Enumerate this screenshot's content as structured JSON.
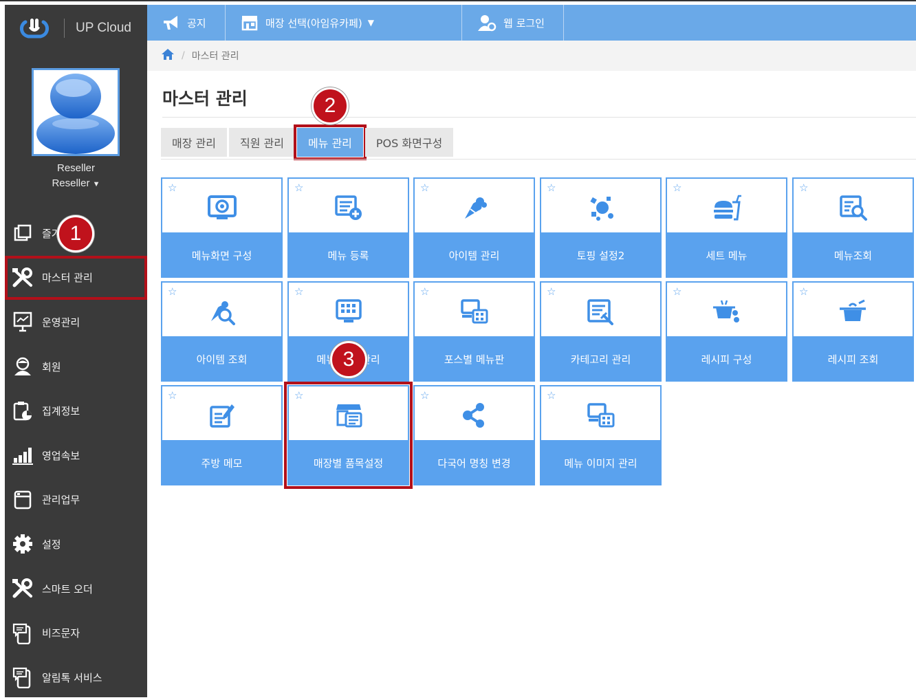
{
  "app": {
    "brand": "UP Cloud"
  },
  "topbar": {
    "notice": "공지",
    "store_select": "매장 선택(아임유카페)",
    "web_login": "웹 로그인"
  },
  "user": {
    "name": "Reseller",
    "role": "Reseller"
  },
  "sidebar": {
    "items": [
      {
        "label": "즐겨찾기",
        "icon": "bookmark-icon"
      },
      {
        "label": "마스터 관리",
        "icon": "tools-icon"
      },
      {
        "label": "운영관리",
        "icon": "monitor-chart-icon"
      },
      {
        "label": "회원",
        "icon": "member-icon"
      },
      {
        "label": "집계정보",
        "icon": "clipboard-chart-icon"
      },
      {
        "label": "영업속보",
        "icon": "bar-chart-icon"
      },
      {
        "label": "관리업무",
        "icon": "document-icon"
      },
      {
        "label": "설정",
        "icon": "gear-icon"
      },
      {
        "label": "스마트 오더",
        "icon": "tools-icon"
      },
      {
        "label": "비즈문자",
        "icon": "phone-chat-icon"
      },
      {
        "label": "알림톡 서비스",
        "icon": "phone-chat-icon"
      }
    ]
  },
  "breadcrumb": {
    "current": "마스터 관리"
  },
  "page": {
    "title": "마스터 관리"
  },
  "tabs": [
    "매장 관리",
    "직원 관리",
    "메뉴 관리",
    "POS 화면구성"
  ],
  "tiles": [
    {
      "label": "메뉴화면 구성",
      "icon": "screen-settings-icon"
    },
    {
      "label": "메뉴 등록",
      "icon": "list-add-icon"
    },
    {
      "label": "아이템 관리",
      "icon": "food-icon"
    },
    {
      "label": "토핑 설정2",
      "icon": "topping-icon"
    },
    {
      "label": "세트 메뉴",
      "icon": "burger-set-icon"
    },
    {
      "label": "메뉴조회",
      "icon": "list-search-icon"
    },
    {
      "label": "아이템 조회",
      "icon": "food-search-icon"
    },
    {
      "label": "메뉴 버튼 관리",
      "icon": "keypad-icon"
    },
    {
      "label": "포스별 메뉴판",
      "icon": "pos-menu-icon"
    },
    {
      "label": "카테고리 관리",
      "icon": "category-icon"
    },
    {
      "label": "레시피 구성",
      "icon": "recipe-icon"
    },
    {
      "label": "레시피 조회",
      "icon": "pot-icon"
    },
    {
      "label": "주방 메모",
      "icon": "memo-icon"
    },
    {
      "label": "매장별 품목설정",
      "icon": "store-items-icon"
    },
    {
      "label": "다국어 명칭 변경",
      "icon": "share-icon"
    },
    {
      "label": "메뉴 이미지 관리",
      "icon": "image-manage-icon"
    }
  ],
  "badges": [
    "1",
    "2",
    "3"
  ],
  "colors": {
    "accent": "#6aa9e8",
    "tile": "#5aa2ee",
    "sidebar": "#3a3a3a",
    "highlight": "#b2101a",
    "badge": "#c0121c"
  }
}
